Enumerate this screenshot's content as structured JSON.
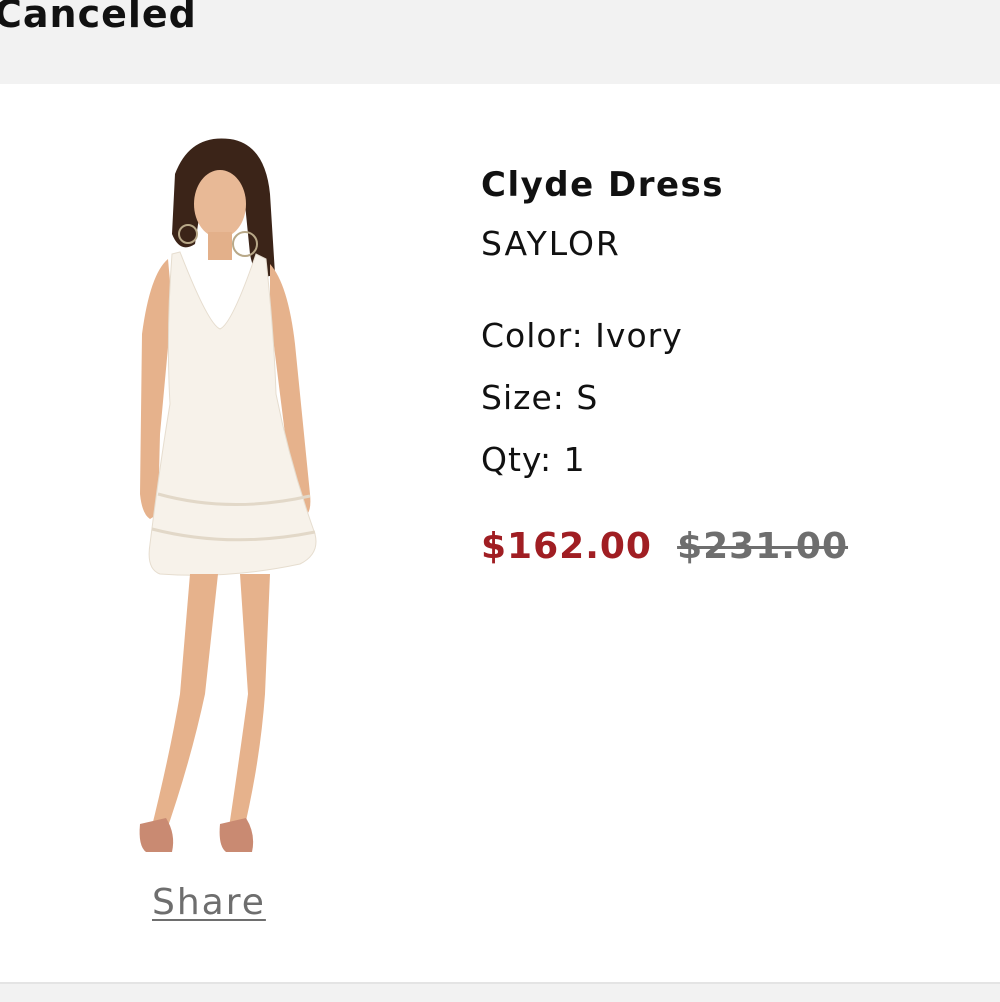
{
  "order": {
    "status": "Canceled"
  },
  "product": {
    "name": "Clyde Dress",
    "brand": "SAYLOR",
    "color": "Color: Ivory",
    "size": "Size: S",
    "qty": "Qty: 1",
    "sale_price": "$162.00",
    "original_price": "$231.00",
    "share_label": "Share",
    "image_icon": "product-photo-dress"
  },
  "colors": {
    "sale": "#a01e23",
    "muted": "#6e6e6e",
    "header_bg": "#f2f2f2"
  }
}
